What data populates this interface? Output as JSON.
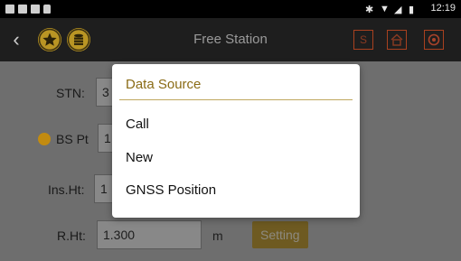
{
  "status_bar": {
    "time": "12:19"
  },
  "app_bar": {
    "title": "Free Station",
    "back_icon": "chevron-left",
    "star_icon": "star",
    "database_icon": "database",
    "s_button_label": "S",
    "home_icon": "home",
    "target_icon": "target"
  },
  "form": {
    "stn_label": "STN:",
    "stn_value": "3",
    "bs_pt_label": "BS Pt",
    "bs_pt_value": "1",
    "ins_ht_label": "Ins.Ht:",
    "ins_ht_value": "1",
    "r_ht_label": "R.Ht:",
    "r_ht_value": "1.300",
    "r_ht_unit": "m",
    "setting_button_label": "Setting"
  },
  "dialog": {
    "title": "Data Source",
    "options": [
      "Call",
      "New",
      "GNSS Position"
    ]
  },
  "colors": {
    "accent_gold": "#b99524",
    "dialog_title": "#8a6b15"
  }
}
